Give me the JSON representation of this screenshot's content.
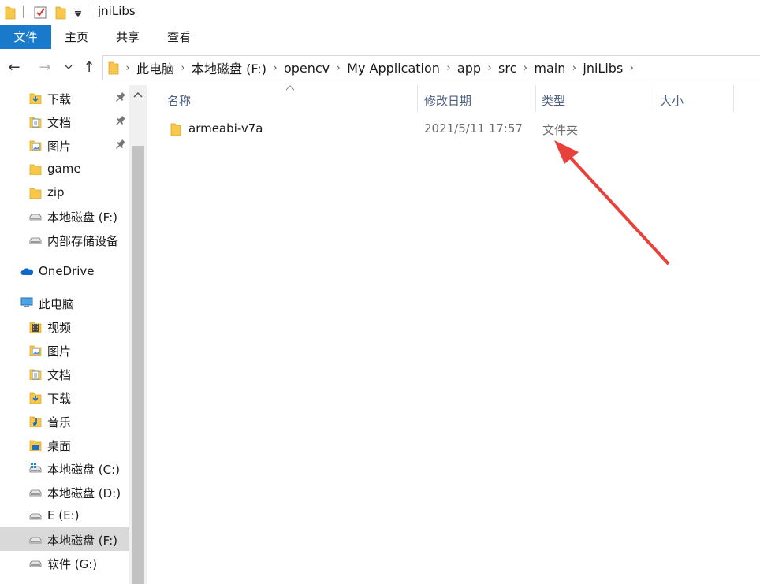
{
  "window": {
    "title": "jniLibs"
  },
  "ribbon": {
    "tabs": [
      "文件",
      "主页",
      "共享",
      "查看"
    ]
  },
  "address": {
    "crumbs": [
      "此电脑",
      "本地磁盘 (F:)",
      "opencv",
      "My Application",
      "app",
      "src",
      "main",
      "jniLibs"
    ]
  },
  "sidebar": {
    "items": [
      {
        "label": "下载",
        "icon": "download-folder-icon",
        "pinned": true
      },
      {
        "label": "文档",
        "icon": "documents-folder-icon",
        "pinned": true
      },
      {
        "label": "图片",
        "icon": "pictures-folder-icon",
        "pinned": true
      },
      {
        "label": "game",
        "icon": "folder-icon"
      },
      {
        "label": "zip",
        "icon": "folder-icon"
      },
      {
        "label": "本地磁盘 (F:)",
        "icon": "drive-icon"
      },
      {
        "label": "内部存储设备",
        "icon": "drive-icon"
      },
      {
        "label": "OneDrive",
        "icon": "onedrive-cloud-icon"
      },
      {
        "label": "此电脑",
        "icon": "this-pc-icon"
      },
      {
        "label": "视频",
        "icon": "videos-folder-icon"
      },
      {
        "label": "图片",
        "icon": "pictures-folder-icon"
      },
      {
        "label": "文档",
        "icon": "documents-folder-icon"
      },
      {
        "label": "下载",
        "icon": "download-folder-icon"
      },
      {
        "label": "音乐",
        "icon": "music-folder-icon"
      },
      {
        "label": "桌面",
        "icon": "desktop-folder-icon"
      },
      {
        "label": "本地磁盘 (C:)",
        "icon": "windows-drive-icon"
      },
      {
        "label": "本地磁盘 (D:)",
        "icon": "drive-icon"
      },
      {
        "label": "E (E:)",
        "icon": "drive-icon"
      },
      {
        "label": "本地磁盘 (F:)",
        "icon": "drive-icon",
        "selected": true
      },
      {
        "label": "软件 (G:)",
        "icon": "drive-icon"
      }
    ]
  },
  "columns": {
    "name": "名称",
    "date": "修改日期",
    "type": "类型",
    "size": "大小"
  },
  "files": [
    {
      "name": "armeabi-v7a",
      "date": "2021/5/11 17:57",
      "type": "文件夹"
    }
  ],
  "colors": {
    "accent": "#1979ca",
    "annotation_arrow": "#e8403a",
    "folder": "#f8c84a"
  }
}
